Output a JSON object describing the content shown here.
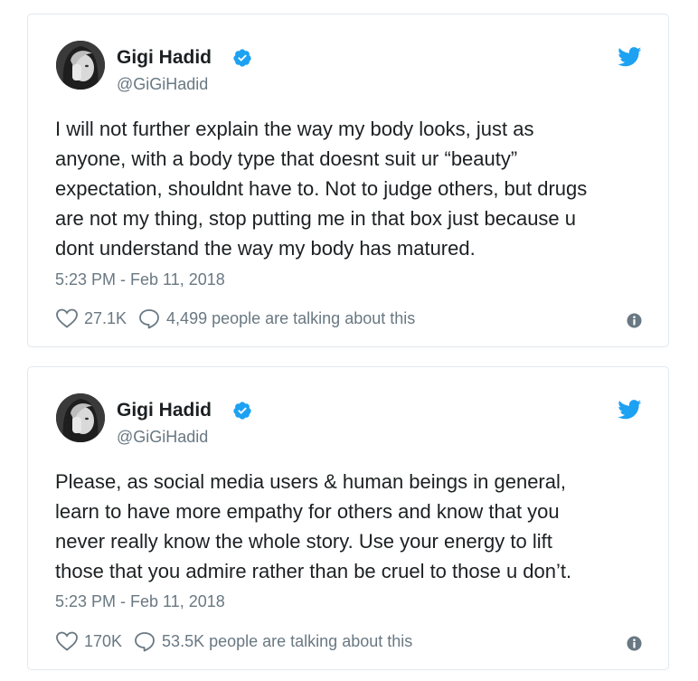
{
  "tweets": [
    {
      "author": {
        "name": "Gigi Hadid",
        "handle": "@GiGiHadid",
        "verified": true
      },
      "text_lines": [
        "I will not further explain the way my body looks, just as",
        "anyone, with a  body type that doesnt suit ur “beauty”",
        "expectation, shouldnt have to. Not to judge others, but drugs",
        "are not my thing, stop putting me in that box just because u",
        "dont understand the way my body has matured."
      ],
      "timestamp": "5:23 PM - Feb 11, 2018",
      "likes": "27.1K",
      "talking": "4,499 people are talking about this"
    },
    {
      "author": {
        "name": "Gigi Hadid",
        "handle": "@GiGiHadid",
        "verified": true
      },
      "text_lines": [
        "Please, as social media users & human beings in general,",
        "learn to have more empathy for others and know that you",
        "never really know the whole story. Use your energy to lift",
        "those that you admire rather than be cruel to those u don’t."
      ],
      "timestamp": "5:23 PM - Feb 11, 2018",
      "likes": "170K",
      "talking": "53.5K people are talking about this"
    }
  ],
  "colors": {
    "twitter_blue": "#1da1f2",
    "secondary_text": "#697882",
    "primary_text": "#1c2022",
    "border": "#e1e8ed"
  },
  "icons": [
    "heart-icon",
    "reply-icon",
    "info-icon",
    "verified-icon",
    "twitter-bird-icon"
  ]
}
